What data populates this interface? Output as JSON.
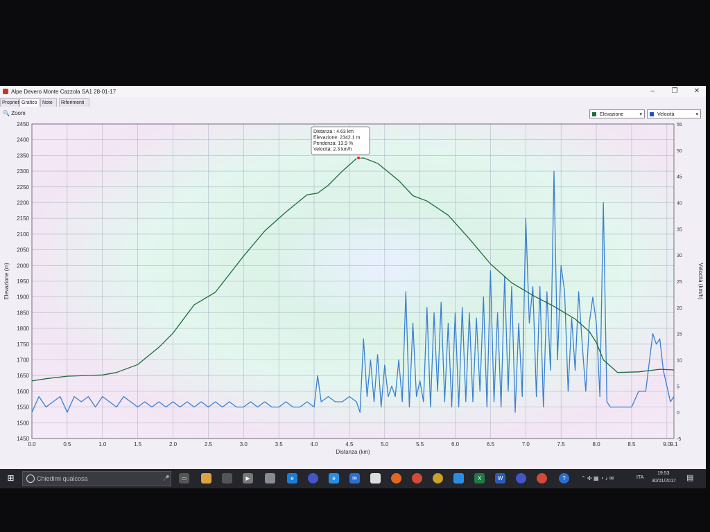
{
  "window": {
    "title": "Alpe Devero Monte Cazzola SA1 28-01-17",
    "tabs": [
      "Proprietà",
      "Grafico",
      "Note",
      "Riferimenti"
    ],
    "active_tab": 1,
    "zoom_label": "Zoom",
    "dropdowns": [
      {
        "label": "Elevazione",
        "color": "#1e6b3a"
      },
      {
        "label": "Velocità",
        "color": "#1f4fbf"
      }
    ]
  },
  "tooltip": {
    "lines": [
      "Distanza : 4.63 km",
      "Elevazione: 2342.1 m",
      "Pendenza: 13.9 %",
      "Velocità: 2.3 km/h"
    ]
  },
  "chart_data": {
    "type": "line",
    "xlabel": "Distanza  (km)",
    "ylabel": "Elevazione (m)",
    "y2label": "Velocità (km/h)",
    "xlim": [
      0,
      9.1
    ],
    "ylim": [
      1450,
      2450
    ],
    "y2lim": [
      -5,
      55
    ],
    "xticks": [
      0,
      0.5,
      1,
      1.5,
      2,
      2.5,
      3,
      3.5,
      4,
      4.5,
      5,
      5.5,
      6,
      6.5,
      7,
      7.5,
      8,
      8.5,
      9
    ],
    "xtick_labels": [
      "0.0",
      "0.5",
      "1.0",
      "1.5",
      "2.0",
      "2.5",
      "3.0",
      "3.5",
      "4.0",
      "4.5",
      "5.0",
      "5.5",
      "6.0",
      "6.5",
      "7.0",
      "7.5",
      "8.0",
      "8.5",
      "9.0",
      "9.1"
    ],
    "yticks": [
      1450,
      1500,
      1550,
      1600,
      1650,
      1700,
      1750,
      1800,
      1850,
      1900,
      1950,
      2000,
      2050,
      2100,
      2150,
      2200,
      2250,
      2300,
      2350,
      2400,
      2450
    ],
    "y2ticks": [
      -5,
      0,
      5,
      10,
      15,
      20,
      25,
      30,
      35,
      40,
      45,
      50,
      55
    ],
    "grid": true,
    "series": [
      {
        "name": "Elevazione",
        "axis": "left",
        "color": "#1e6b3a",
        "x": [
          0,
          0.2,
          0.5,
          1.0,
          1.2,
          1.5,
          1.8,
          2.0,
          2.3,
          2.6,
          3.0,
          3.3,
          3.6,
          3.9,
          4.05,
          4.2,
          4.4,
          4.6,
          4.7,
          4.9,
          5.2,
          5.4,
          5.6,
          5.9,
          6.2,
          6.5,
          6.8,
          7.1,
          7.4,
          7.7,
          7.9,
          8.0,
          8.1,
          8.3,
          8.6,
          8.9,
          9.1
        ],
        "y": [
          1633,
          1640,
          1648,
          1652,
          1660,
          1685,
          1740,
          1785,
          1875,
          1915,
          2030,
          2110,
          2170,
          2225,
          2230,
          2255,
          2300,
          2340,
          2342,
          2325,
          2270,
          2222,
          2205,
          2160,
          2085,
          2005,
          1945,
          1905,
          1870,
          1830,
          1790,
          1755,
          1700,
          1660,
          1662,
          1670,
          1668
        ]
      },
      {
        "name": "Velocità",
        "axis": "right",
        "color": "#3b7fd0",
        "x": [
          0,
          0.1,
          0.2,
          0.3,
          0.4,
          0.5,
          0.6,
          0.7,
          0.8,
          0.9,
          1.0,
          1.1,
          1.2,
          1.3,
          1.4,
          1.5,
          1.6,
          1.7,
          1.8,
          1.9,
          2.0,
          2.1,
          2.2,
          2.3,
          2.4,
          2.5,
          2.6,
          2.7,
          2.8,
          2.9,
          3.0,
          3.1,
          3.2,
          3.3,
          3.4,
          3.5,
          3.6,
          3.7,
          3.8,
          3.9,
          4.0,
          4.05,
          4.1,
          4.2,
          4.3,
          4.4,
          4.5,
          4.6,
          4.65,
          4.7,
          4.75,
          4.8,
          4.85,
          4.9,
          4.95,
          5.0,
          5.05,
          5.1,
          5.15,
          5.2,
          5.25,
          5.3,
          5.35,
          5.4,
          5.45,
          5.5,
          5.55,
          5.6,
          5.65,
          5.7,
          5.75,
          5.8,
          5.85,
          5.9,
          5.95,
          6.0,
          6.05,
          6.1,
          6.15,
          6.2,
          6.25,
          6.3,
          6.35,
          6.4,
          6.45,
          6.5,
          6.55,
          6.6,
          6.65,
          6.7,
          6.75,
          6.8,
          6.85,
          6.9,
          6.95,
          7.0,
          7.05,
          7.1,
          7.15,
          7.2,
          7.25,
          7.3,
          7.35,
          7.4,
          7.45,
          7.5,
          7.55,
          7.6,
          7.65,
          7.7,
          7.75,
          7.8,
          7.85,
          7.9,
          7.95,
          8.0,
          8.05,
          8.1,
          8.15,
          8.2,
          8.3,
          8.4,
          8.5,
          8.6,
          8.7,
          8.8,
          8.85,
          8.9,
          8.95,
          9.0,
          9.05,
          9.1
        ],
        "y": [
          0,
          3,
          1,
          2,
          3,
          0,
          3,
          2,
          3,
          1,
          3,
          2,
          1,
          3,
          2,
          1,
          2,
          1,
          2,
          1,
          2,
          1,
          2,
          1,
          2,
          1,
          2,
          1,
          2,
          1,
          1,
          2,
          1,
          2,
          1,
          1,
          2,
          1,
          1,
          2,
          1,
          7,
          2,
          3,
          2,
          2,
          3,
          2,
          0,
          14,
          3,
          10,
          2,
          11,
          1,
          9,
          3,
          5,
          3,
          10,
          2,
          23,
          1,
          17,
          3,
          6,
          2,
          20,
          1,
          19,
          4,
          21,
          2,
          17,
          1,
          19,
          1,
          20,
          2,
          19,
          2,
          18,
          4,
          22,
          1,
          27,
          2,
          19,
          1,
          26,
          4,
          24,
          0,
          17,
          3,
          37,
          17,
          24,
          3,
          24,
          1,
          23,
          8,
          46,
          10,
          28,
          23,
          4,
          18,
          8,
          23,
          13,
          4,
          17,
          22,
          17,
          3,
          40,
          2,
          1,
          1,
          1,
          1,
          4,
          4,
          15,
          13,
          14,
          8,
          5,
          2,
          3
        ]
      }
    ]
  },
  "taskbar": {
    "search_placeholder": "Chiedimi qualcosa",
    "lang": "ITA",
    "time": "19:53",
    "date": "30/01/2017"
  }
}
